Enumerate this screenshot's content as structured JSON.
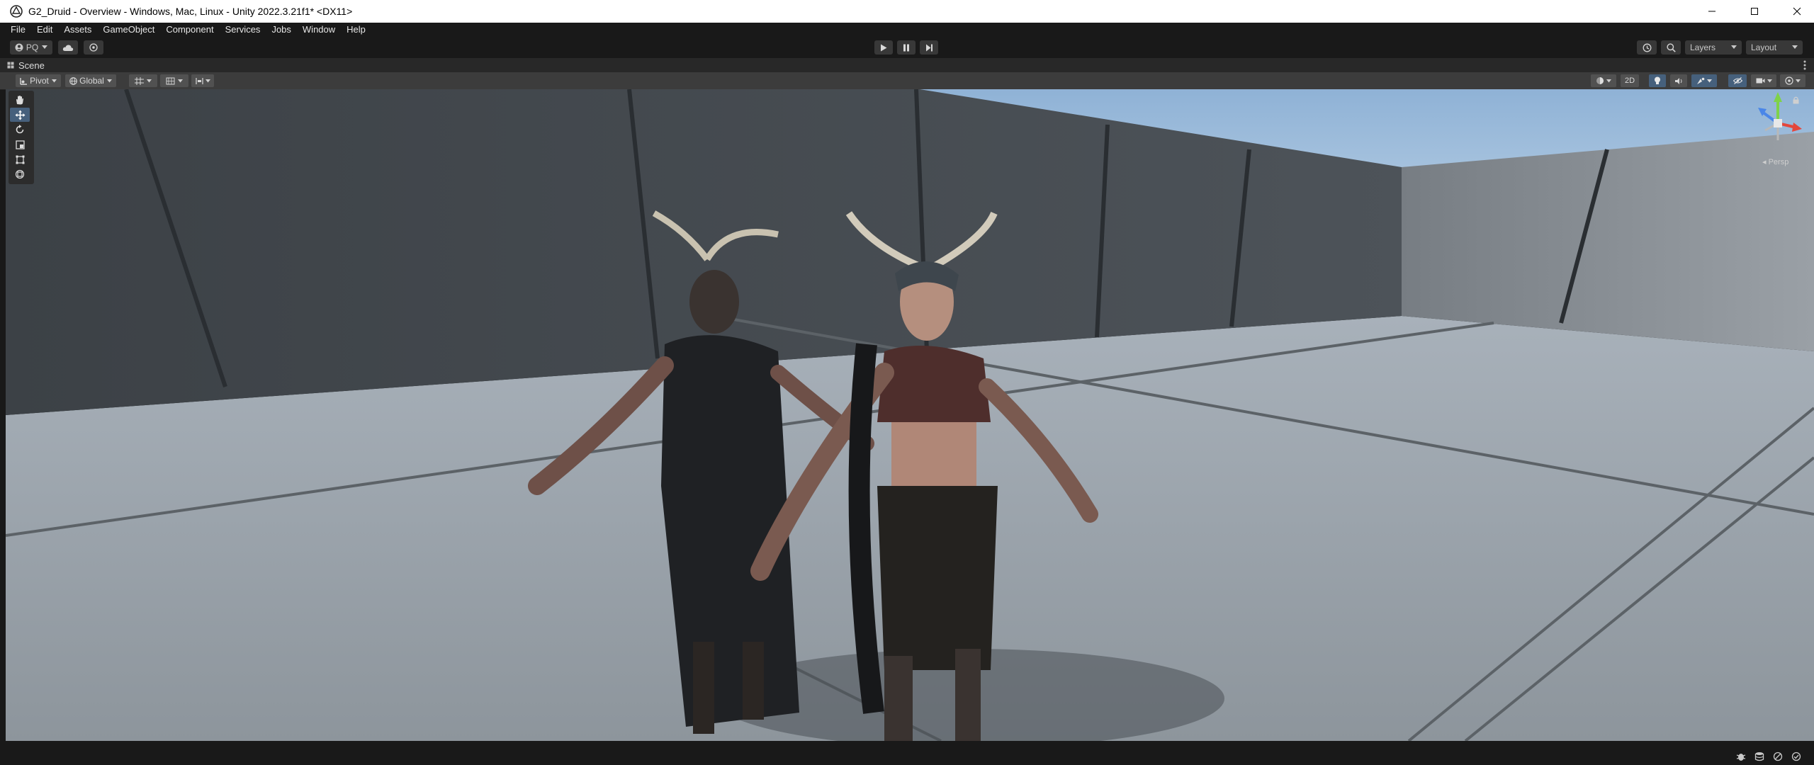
{
  "window": {
    "title": "G2_Druid - Overview - Windows, Mac, Linux - Unity 2022.3.21f1* <DX11>"
  },
  "menu": [
    "File",
    "Edit",
    "Assets",
    "GameObject",
    "Component",
    "Services",
    "Jobs",
    "Window",
    "Help"
  ],
  "toolbar": {
    "account_label": "PQ",
    "layers_label": "Layers",
    "layout_label": "Layout"
  },
  "scene_tab": {
    "label": "Scene"
  },
  "scene_toolbar": {
    "pivot_label": "Pivot",
    "global_label": "Global",
    "mode_2d_label": "2D"
  },
  "gizmo": {
    "projection_label": "Persp"
  },
  "colors": {
    "editor_bg": "#191919",
    "panel_bg": "#282828",
    "toolbar_bg": "#3c3c3c",
    "active_blue": "#46607c",
    "sky": "#9fbfe0"
  },
  "icons": {
    "unity": "unity-logo-icon",
    "cloud": "cloud-icon",
    "collab": "collab-icon",
    "play": "play-icon",
    "pause": "pause-icon",
    "step": "step-icon",
    "history": "history-icon",
    "search": "search-icon"
  }
}
